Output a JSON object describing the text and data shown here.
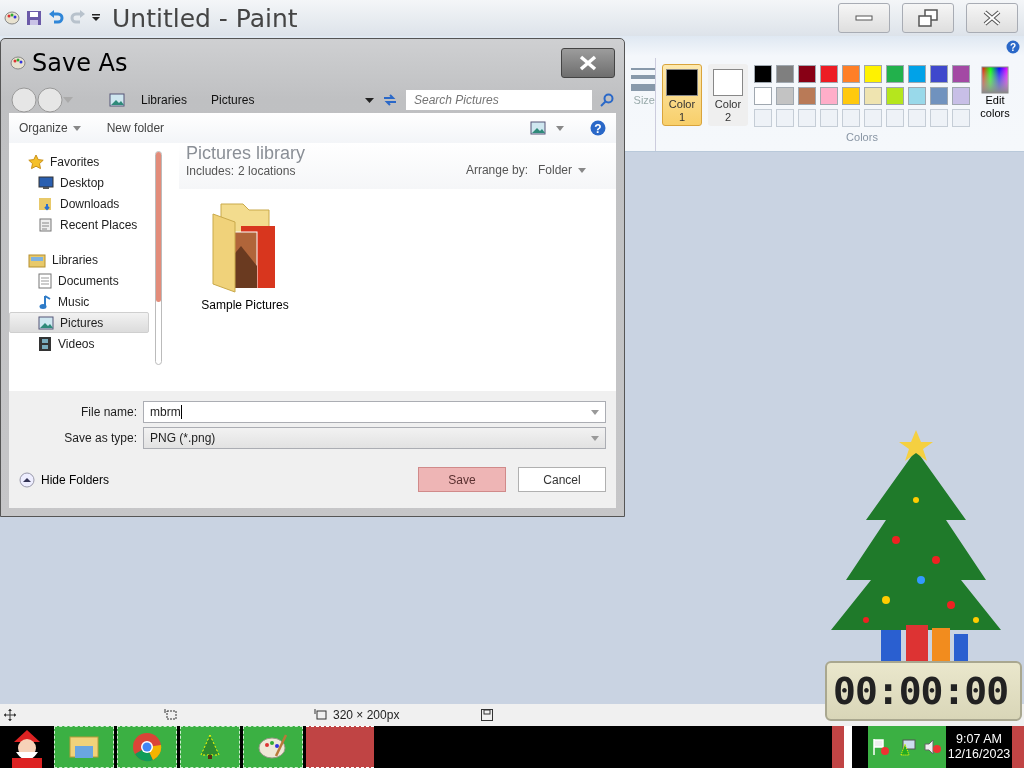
{
  "window": {
    "title": "Untitled - Paint"
  },
  "help_icon": "?",
  "ribbon": {
    "size_label": "Size",
    "colors": [
      {
        "label": "Color 1",
        "selected": true,
        "color": "#000000"
      },
      {
        "label": "Color 2",
        "selected": false,
        "color": "#ffffff"
      }
    ],
    "palette": [
      {
        "color": "#000000"
      },
      {
        "color": "#7f7f7f"
      },
      {
        "color": "#880015"
      },
      {
        "color": "#ed1c24"
      },
      {
        "color": "#ff7f27"
      },
      {
        "color": "#fff200"
      },
      {
        "color": "#22b14c"
      },
      {
        "color": "#00a2e8"
      },
      {
        "color": "#3f48cc"
      },
      {
        "color": "#a349a4"
      },
      {
        "color": "#ffffff"
      },
      {
        "color": "#c3c3c3"
      },
      {
        "color": "#b97a57"
      },
      {
        "color": "#ffaec9"
      },
      {
        "color": "#ffc90e"
      },
      {
        "color": "#efe4b0"
      },
      {
        "color": "#b5e61d"
      },
      {
        "color": "#99d9ea"
      },
      {
        "color": "#7092be"
      },
      {
        "color": "#c8bfe7"
      }
    ],
    "edit_colors": "Edit colors",
    "group_label": "Colors"
  },
  "dialog": {
    "title": "Save As",
    "breadcrumb": [
      "Libraries",
      "Pictures"
    ],
    "search": {
      "placeholder": "Search Pictures"
    },
    "organize": "Organize",
    "new_folder": "New folder",
    "nav": [
      {
        "label": "Favorites",
        "kind": "favorites",
        "children": [
          {
            "label": "Desktop",
            "kind": "desktop",
            "selected": false
          },
          {
            "label": "Downloads",
            "kind": "downloads",
            "selected": false
          },
          {
            "label": "Recent Places",
            "kind": "recent",
            "selected": false
          }
        ]
      },
      {
        "label": "Libraries",
        "kind": "libraries",
        "children": [
          {
            "label": "Documents",
            "kind": "documents",
            "selected": false
          },
          {
            "label": "Music",
            "kind": "music",
            "selected": false
          },
          {
            "label": "Pictures",
            "kind": "pictures",
            "selected": true
          },
          {
            "label": "Videos",
            "kind": "videos",
            "selected": false
          }
        ]
      }
    ],
    "library": {
      "title": "Pictures library",
      "includes": "Includes:",
      "locations": "2 locations",
      "arrange_label": "Arrange by:",
      "arrange_value": "Folder"
    },
    "items": [
      {
        "label": "Sample Pictures"
      }
    ],
    "file_name": {
      "label": "File name:",
      "value": "mbrm"
    },
    "save_type": {
      "label": "Save as type:",
      "value": "PNG (*.png)"
    },
    "hide_folders": "Hide Folders",
    "buttons": [
      {
        "label": "Save",
        "kind": "primary"
      },
      {
        "label": "Cancel",
        "kind": "normal"
      }
    ]
  },
  "status_bar": {
    "size": "320 × 200px"
  },
  "timer": {
    "reading": "00:00:00"
  },
  "taskbar": {
    "time": "9:07 AM",
    "date": "12/16/2023"
  }
}
